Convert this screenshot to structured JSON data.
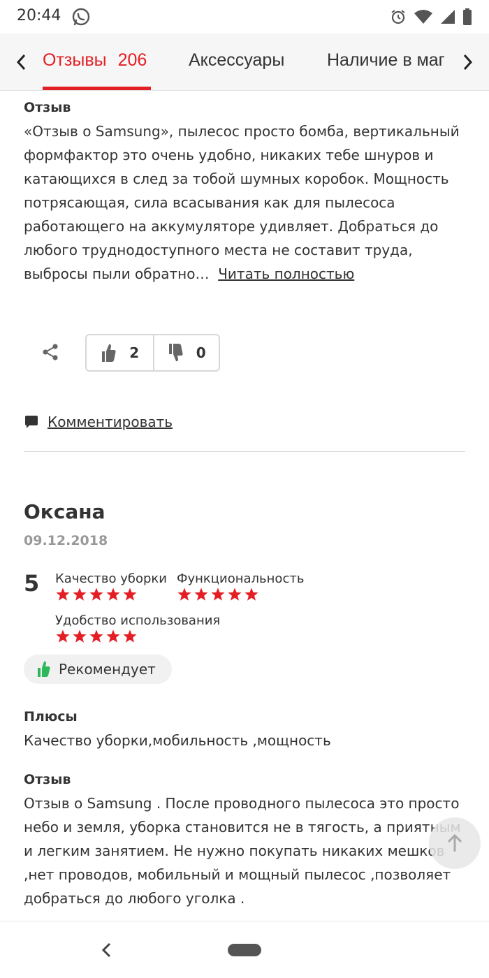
{
  "status_bar": {
    "time": "20:44",
    "icons": [
      "whatsapp-icon",
      "alarm-icon",
      "wifi-icon",
      "signal-icon",
      "battery-icon"
    ]
  },
  "tabs": {
    "items": [
      {
        "label": "Отзывы",
        "count": "206",
        "active": true
      },
      {
        "label": "Аксессуары",
        "active": false
      },
      {
        "label": "Наличие в маг",
        "active": false
      }
    ],
    "accent_color": "#e31e24"
  },
  "review1": {
    "label": "Отзыв",
    "text": "«Отзыв о Samsung», пылесос просто бомба, вертикальный формфактор это очень удобно, никаких тебе шнуров и катающихся в след за тобой шумных коробок. Мощность потрясающая, сила всасывания как для пылесоса работающего на аккумуляторе удивляет. Добраться до любого труднодоступного места не составит труда, выбросы пыли обратно…",
    "read_more": "Читать полностью",
    "likes": "2",
    "dislikes": "0",
    "comment_label": "Комментировать"
  },
  "review2": {
    "author": "Оксана",
    "date": "09.12.2018",
    "score": "5",
    "criteria": [
      {
        "label": "Качество уборки",
        "stars": 5
      },
      {
        "label": "Функциональность",
        "stars": 5
      },
      {
        "label": "Удобство использования",
        "stars": 5
      }
    ],
    "recommend_label": "Рекомендует",
    "pros_label": "Плюсы",
    "pros_text": "Качество уборки,мобильность ,мощность",
    "review_label": "Отзыв",
    "review_text": "Отзыв о Samsung . После проводного пылесоса это просто небо и земля, уборка становится не в тягость, а приятным и легким занятием. Не нужно покупать никаких мешков ,нет проводов, мобильный и мощный пылесос ,позволяет добраться до любого уголка ."
  },
  "colors": {
    "star": "#e31e24",
    "recommend_thumb": "#2eb85c"
  }
}
